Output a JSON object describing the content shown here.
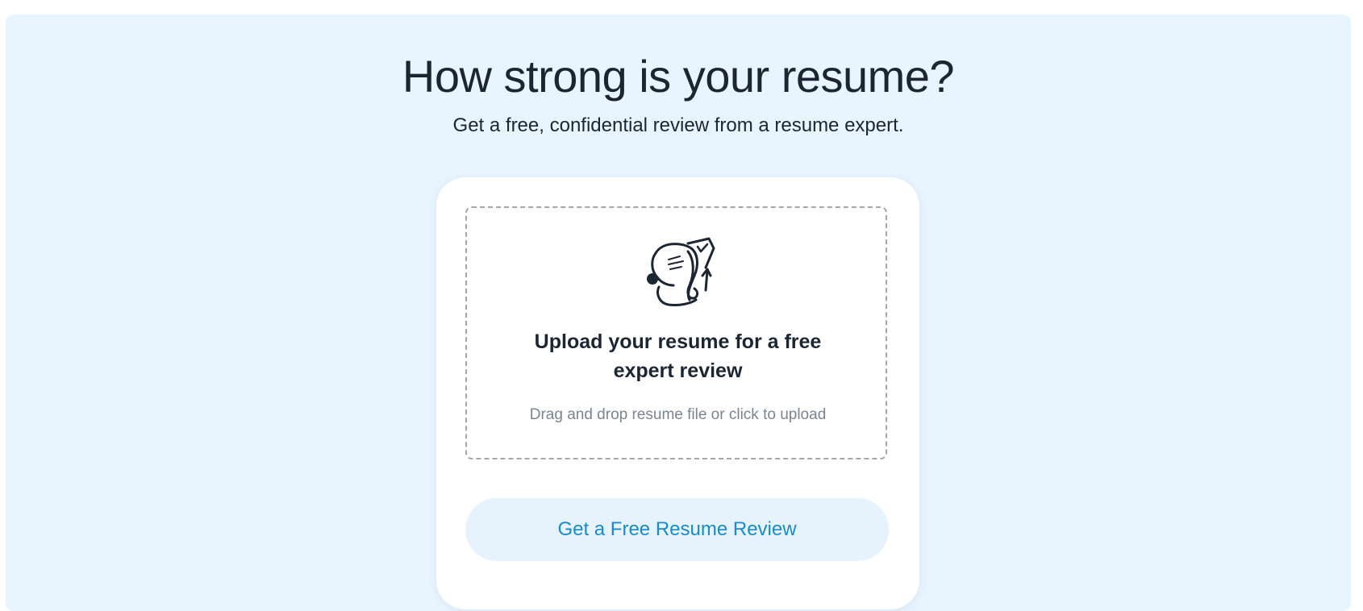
{
  "hero": {
    "title": "How strong is your resume?",
    "subtitle": "Get a free, confidential review from a resume expert."
  },
  "dropzone": {
    "icon": "resume-upload-icon",
    "title_line1": "Upload your resume for a free",
    "title_line2": "expert review",
    "hint": "Drag and drop resume file or click to upload"
  },
  "cta": {
    "label": "Get a Free Resume Review"
  },
  "colors": {
    "panel_background": "#e8f4fe",
    "text_dark": "#1c2633",
    "text_muted": "#7b8590",
    "button_background": "#e6f3fd",
    "button_text": "#1a8bc6"
  }
}
